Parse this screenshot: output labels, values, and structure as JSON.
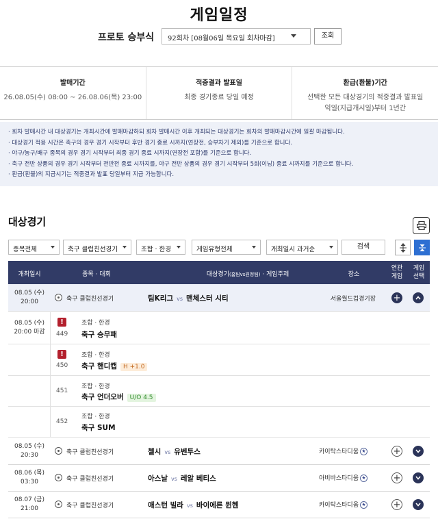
{
  "page": {
    "title": "게임일정"
  },
  "round": {
    "label": "프로토 승부식",
    "selected": "92회차 [08월06일 목요일 회차마감]",
    "query_label": "조회"
  },
  "info": [
    {
      "heading": "발매기간",
      "value": "26.08.05(수) 08:00 ~ 26.08.06(목) 23:00"
    },
    {
      "heading": "적중결과 발표일",
      "value": "최종 경기종료 당일 예정"
    },
    {
      "heading": "환급(환불)기간",
      "value": "선택한 모든 대상경기의 적중결과 발표일",
      "value2": "익일(지급개시일)부터 1년간"
    }
  ],
  "notices": [
    "회차 발매시간 내 대상경기는 개최시간에 발매마감하되 회차 발매시간 이후 개최되는 대상경기는 회차의 발매마감시간에 일괄 마감됩니다.",
    "대상경기 적용 시간은 축구의 경우 경기 시작부터 후반 경기 종료 시까지(연장전, 승부차기 제외)를 기준으로 합니다.",
    "야구/농구/배구 종목의 경우 경기 시작부터 최종 경기 종료 시까지(연장전 포함)를 기준으로 합니다.",
    "축구 전반 상품의 경우 경기 시작부터 전반전 종료 시까지를, 야구 전반 상품의 경우 경기 시작부터 5회(이닝) 종료 시까지를 기준으로 합니다.",
    "환급(환불)의 지급시기는 적중결과 발표 당일부터 지급 가능합니다."
  ],
  "section": {
    "title": "대상경기"
  },
  "filters": {
    "sport": "종목전체",
    "league": "축구 클럽친선경기",
    "combo": "조합 · 한경",
    "type": "게임유형전체",
    "order": "개최일시 과거순",
    "search_label": "검색"
  },
  "headers": {
    "datetime": "개최일시",
    "sport": "종목 · 대회",
    "match": "대상경기",
    "match_sub": "(홈팀vs원정팀)",
    "match_tail": "· 게임주제",
    "venue": "장소",
    "related1": "연관",
    "related2": "게임",
    "select1": "게임",
    "select2": "선택"
  },
  "matches": [
    {
      "date": "08.05 (수)",
      "time": "20:00",
      "league": "축구 클럽친선경기",
      "home": "팀K리그",
      "vs": "vs",
      "away": "맨체스터 시티",
      "venue": "서울월드컵경기장",
      "star": false
    },
    {
      "date": "08.05 (수)",
      "time": "20:30",
      "league": "축구 클럽친선경기",
      "home": "첼시",
      "vs": "vs",
      "away": "유벤투스",
      "venue": "카이탁스타디움",
      "star": true
    },
    {
      "date": "08.06 (목)",
      "time": "03:30",
      "league": "축구 클럽친선경기",
      "home": "아스날",
      "vs": "vs",
      "away": "레알 베티스",
      "venue": "아비바스타디움",
      "star": true
    },
    {
      "date": "08.07 (금)",
      "time": "21:00",
      "league": "축구 클럽친선경기",
      "home": "애스턴 빌라",
      "vs": "vs",
      "away": "바이에른 뮌헨",
      "venue": "카이탁스타디움",
      "star": true
    }
  ],
  "sub_date": {
    "date": "08.05 (수)",
    "time": "20:00 마감"
  },
  "sub_games": [
    {
      "no": "449",
      "category": "조합 · 한경",
      "name": "축구 승무패",
      "tag": "",
      "warn": true
    },
    {
      "no": "450",
      "category": "조합 · 한경",
      "name": "축구 핸디캡",
      "tag": "H +1.0",
      "warn": true
    },
    {
      "no": "451",
      "category": "조합 · 한경",
      "name": "축구 언더오버",
      "tag": "U/O 4.5",
      "warn": false
    },
    {
      "no": "452",
      "category": "조합 · 한경",
      "name": "축구 SUM",
      "tag": "",
      "warn": false
    }
  ],
  "icons": {
    "print": "printer-icon",
    "expand": "expand-all-icon",
    "collapse": "collapse-all-icon",
    "ball": "soccer-ball-icon",
    "star": "star-icon",
    "plus": "plus-icon",
    "chevron": "chevron-icon",
    "warning": "warning-icon"
  },
  "colors": {
    "header_bg": "#313b66",
    "notice_bg": "#eef1f8",
    "accent": "#2d6fd2",
    "warning": "#b3202d"
  }
}
